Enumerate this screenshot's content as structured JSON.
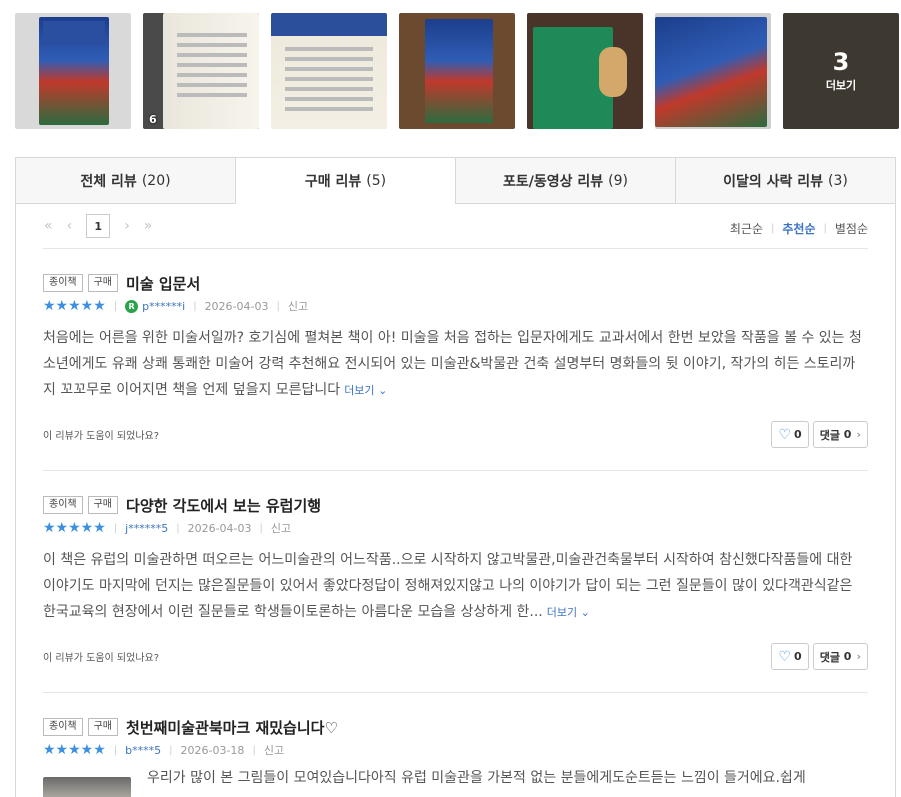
{
  "photos": {
    "thumb2_count": "6",
    "more_count": "3",
    "more_label": "더보기"
  },
  "tabs": [
    {
      "label": "전체 리뷰",
      "count": "(20)"
    },
    {
      "label": "구매 리뷰",
      "count": "(5)"
    },
    {
      "label": "포토/동영상 리뷰",
      "count": "(9)"
    },
    {
      "label": "이달의 사락 리뷰",
      "count": "(3)"
    }
  ],
  "pager": {
    "current": "1"
  },
  "sort": {
    "latest": "최근순",
    "recommended": "추천순",
    "rating": "별점순"
  },
  "reviews": [
    {
      "badge1": "종이책",
      "badge2": "구매",
      "title": "미술 입문서",
      "stars": "★★★★★",
      "user_icon": "R",
      "user": "p******i",
      "date": "2026-04-03",
      "report": "신고",
      "body": "처음에는 어른을 위한 미술서일까? 호기심에 펼쳐본 책이 아! 미술을 처음 접하는 입문자에게도 교과서에서 한번 보았을 작품을 볼 수 있는 청소년에게도 유쾌 상쾌 통쾌한 미술어 강력 추천해요 전시되어 있는 미술관&박물관 건축 설명부터 명화들의 뒷 이야기, 작가의 히든 스토리까지 꼬꼬무로 이어지면 책을 언제 덮을지 모른답니다",
      "more": "더보기",
      "helpful": "이 리뷰가 도움이 되었나요?",
      "likes": "0",
      "comment_label": "댓글",
      "comments": "0"
    },
    {
      "badge1": "종이책",
      "badge2": "구매",
      "title": "다양한 각도에서 보는 유럽기행",
      "stars": "★★★★★",
      "user": "j******5",
      "date": "2026-04-03",
      "report": "신고",
      "body": "이 책은 유럽의 미술관하면 떠오르는 어느미술관의 어느작품..으로 시작하지 않고박물관,미술관건축물부터 시작하여 참신했다작품들에 대한 이야기도 마지막에 던지는 많은질문들이 있어서 좋았다정답이 정해져있지않고 나의 이야기가 답이 되는 그런 질문들이 많이 있다객관식같은 한국교육의 현장에서 이런 질문들로 학생들이토론하는 아름다운 모습을 상상하게 한...",
      "more": "더보기",
      "helpful": "이 리뷰가 도움이 되었나요?",
      "likes": "0",
      "comment_label": "댓글",
      "comments": "0"
    },
    {
      "badge1": "종이책",
      "badge2": "구매",
      "title": "첫번째미술관북마크 재밌습니다♡",
      "stars": "★★★★★",
      "user": "b****5",
      "date": "2026-03-18",
      "report": "신고",
      "body": "우리가 많이 본 그림들이 모여있습니다아직 유럽 미술관을 가본적 없는 분들에게도순트듣는 느낌이 들거에요.쉽게"
    }
  ],
  "colors": {
    "star": "#3d8fe0",
    "link": "#3d74c1",
    "badge_user": "#2ba34a"
  }
}
